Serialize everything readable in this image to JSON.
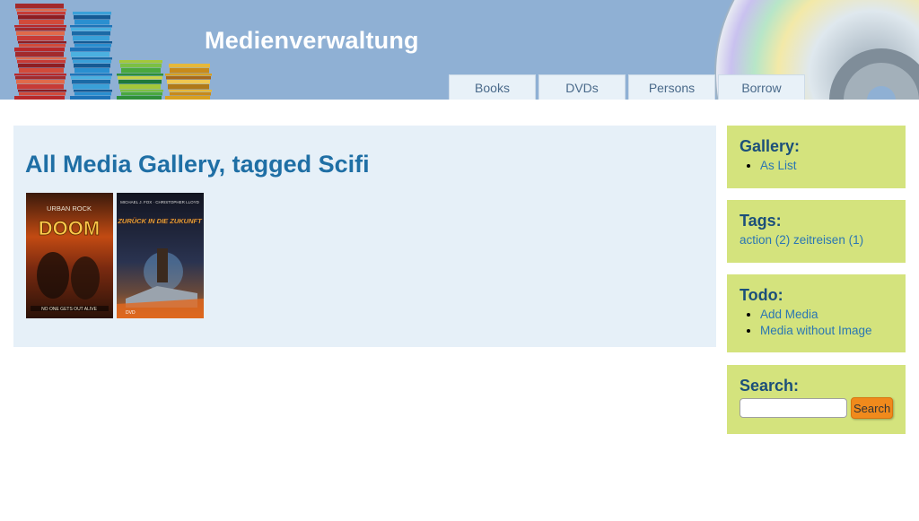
{
  "header": {
    "site_title": "Medienverwaltung",
    "nav": [
      {
        "label": "Books"
      },
      {
        "label": "DVDs"
      },
      {
        "label": "Persons"
      },
      {
        "label": "Borrow"
      }
    ]
  },
  "main": {
    "heading": "All Media Gallery, tagged Scifi",
    "covers": [
      {
        "top_text": "URBAN ROCK",
        "title": "DOOM",
        "bottom_text": "NO ONE GETS OUT ALIVE"
      },
      {
        "top_text": "MICHAEL J. FOX · CHRISTOPHER LLOYD",
        "title": "ZURÜCK IN DIE ZUKUNFT",
        "bottom_text": "DVD"
      }
    ]
  },
  "sidebar": {
    "gallery": {
      "title": "Gallery:",
      "items": [
        "As List"
      ]
    },
    "tags": {
      "title": "Tags:",
      "items": [
        {
          "label": "action (2)"
        },
        {
          "label": "zeitreisen (1)"
        }
      ]
    },
    "todo": {
      "title": "Todo:",
      "items": [
        "Add Media",
        "Media without Image"
      ]
    },
    "search": {
      "title": "Search:",
      "placeholder": "",
      "button": "Search"
    }
  },
  "colors": {
    "header_bg": "#8fb0d4",
    "sidebar_bg": "#d4e37d",
    "main_bg": "#e6f0f8",
    "heading": "#1f6fa5",
    "link": "#2a76b3",
    "search_button": "#f08a1c"
  }
}
